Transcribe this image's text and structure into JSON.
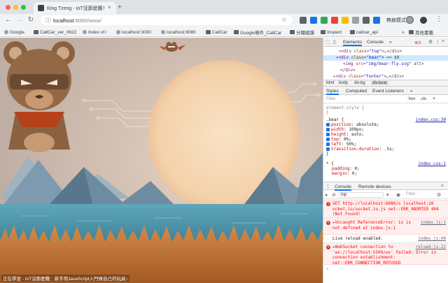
{
  "window": {
    "tab_title": "King Tzeng - IoT沒那麼難！新手",
    "new_tab_symbol": "+",
    "close_symbol": "×"
  },
  "nav": {
    "back": "←",
    "forward": "→",
    "reload": "↻",
    "url_host": "localhost",
    "url_path": ":8080/www/",
    "profile_label": "無痕模式",
    "menu": "⋮",
    "lock": "ⓘ",
    "star": "☆"
  },
  "bookmarks": {
    "items": [
      "Google",
      "CallCar_ver_0622",
      "Index of /",
      "localhost:3000",
      "localhost:8080",
      "CallCar",
      "Google條件_CallCar",
      "分職組課",
      "Inspect",
      "callcar_api"
    ],
    "more": "»",
    "other": "其他書籤"
  },
  "page": {
    "ticker": "正在學習 - IoT沒那麼難：新手用JavaScript入門做自己的玩具~",
    "colors": {
      "sky": "#cfbfb5",
      "sun": "#f6d8b6",
      "sun_glow": "#f1c9a3",
      "mountain_back": "#8ea5b5",
      "mountain_front": "#5c7d93",
      "water": "#4c93a9",
      "grass": "#c77a3a",
      "bear": "#8b6240",
      "cape": "#b5421a"
    }
  },
  "devtools": {
    "tabs": [
      "Elements",
      "Console",
      "»"
    ],
    "error_count": "3",
    "close": "×",
    "elements": [
      {
        "indent": 2,
        "tag_open": "<div ",
        "attr": "class",
        "val": "\"top\"",
        "text": ">…</div>"
      },
      {
        "indent": 2,
        "tag_open": "▾<div ",
        "attr": "class",
        "val": "\"bear\"",
        "text": "> == $0",
        "selected": true
      },
      {
        "indent": 3,
        "tag_open": "<img ",
        "attr": "src",
        "val": "\"img/bear-fly.svg\"",
        "text": " alt>"
      },
      {
        "indent": 2,
        "tag_open": "</div>",
        "attr": "",
        "val": "",
        "text": ""
      },
      {
        "indent": 1,
        "tag_open": "▸<div ",
        "attr": "class",
        "val": "\"footer\"",
        "text": ">…</div>"
      }
    ],
    "breadcrumbs": [
      "html",
      "body",
      "div.bg",
      "div.bear"
    ],
    "style_tabs": [
      "Styles",
      "Computed",
      "Event Listeners",
      "»"
    ],
    "filter_placeholder": "Filter",
    "filter_tools": [
      ":hov",
      ".cls",
      "+"
    ],
    "element_style": [
      "element.style {",
      "}"
    ],
    "rule": {
      "selector": ".bear {",
      "source": "index.css:30",
      "props": [
        {
          "name": "position",
          "value": "absolute;"
        },
        {
          "name": "width",
          "value": "100px;"
        },
        {
          "name": "height",
          "value": "auto;"
        },
        {
          "name": "top",
          "value": "0%;"
        },
        {
          "name": "left",
          "value": "50%;"
        },
        {
          "name": "transition-duration",
          "value": ".5s;"
        }
      ],
      "close": "}"
    },
    "rule2": {
      "selector": "* {",
      "source": "index.css:1",
      "props": [
        {
          "name": "padding",
          "value": "0;"
        },
        {
          "name": "margin",
          "value": "0;"
        }
      ]
    },
    "drawer_tabs": [
      "Console",
      "Remote devices"
    ],
    "context": "top",
    "console_filter": "Filter",
    "messages": [
      {
        "type": "err",
        "text": "GET http://localhost:8080/s localhost:20 ocket.io/socket.io.js net::ERR_ABORTED 404 (Not Found)",
        "source": ""
      },
      {
        "type": "err",
        "text": "▸Uncaught ReferenceError: io is not defined  at index.js:1",
        "source": "index.js:1"
      },
      {
        "type": "log",
        "text": "Live reload enabled.",
        "source": "index.js:49"
      },
      {
        "type": "err",
        "text": "▸WebSocket connection to 'ws://localhost:5500/ws' failed: Error in connection establishment: net::ERR_CONNECTION_REFUSED",
        "source": "reload.js:22"
      }
    ],
    "prompt": "›"
  }
}
